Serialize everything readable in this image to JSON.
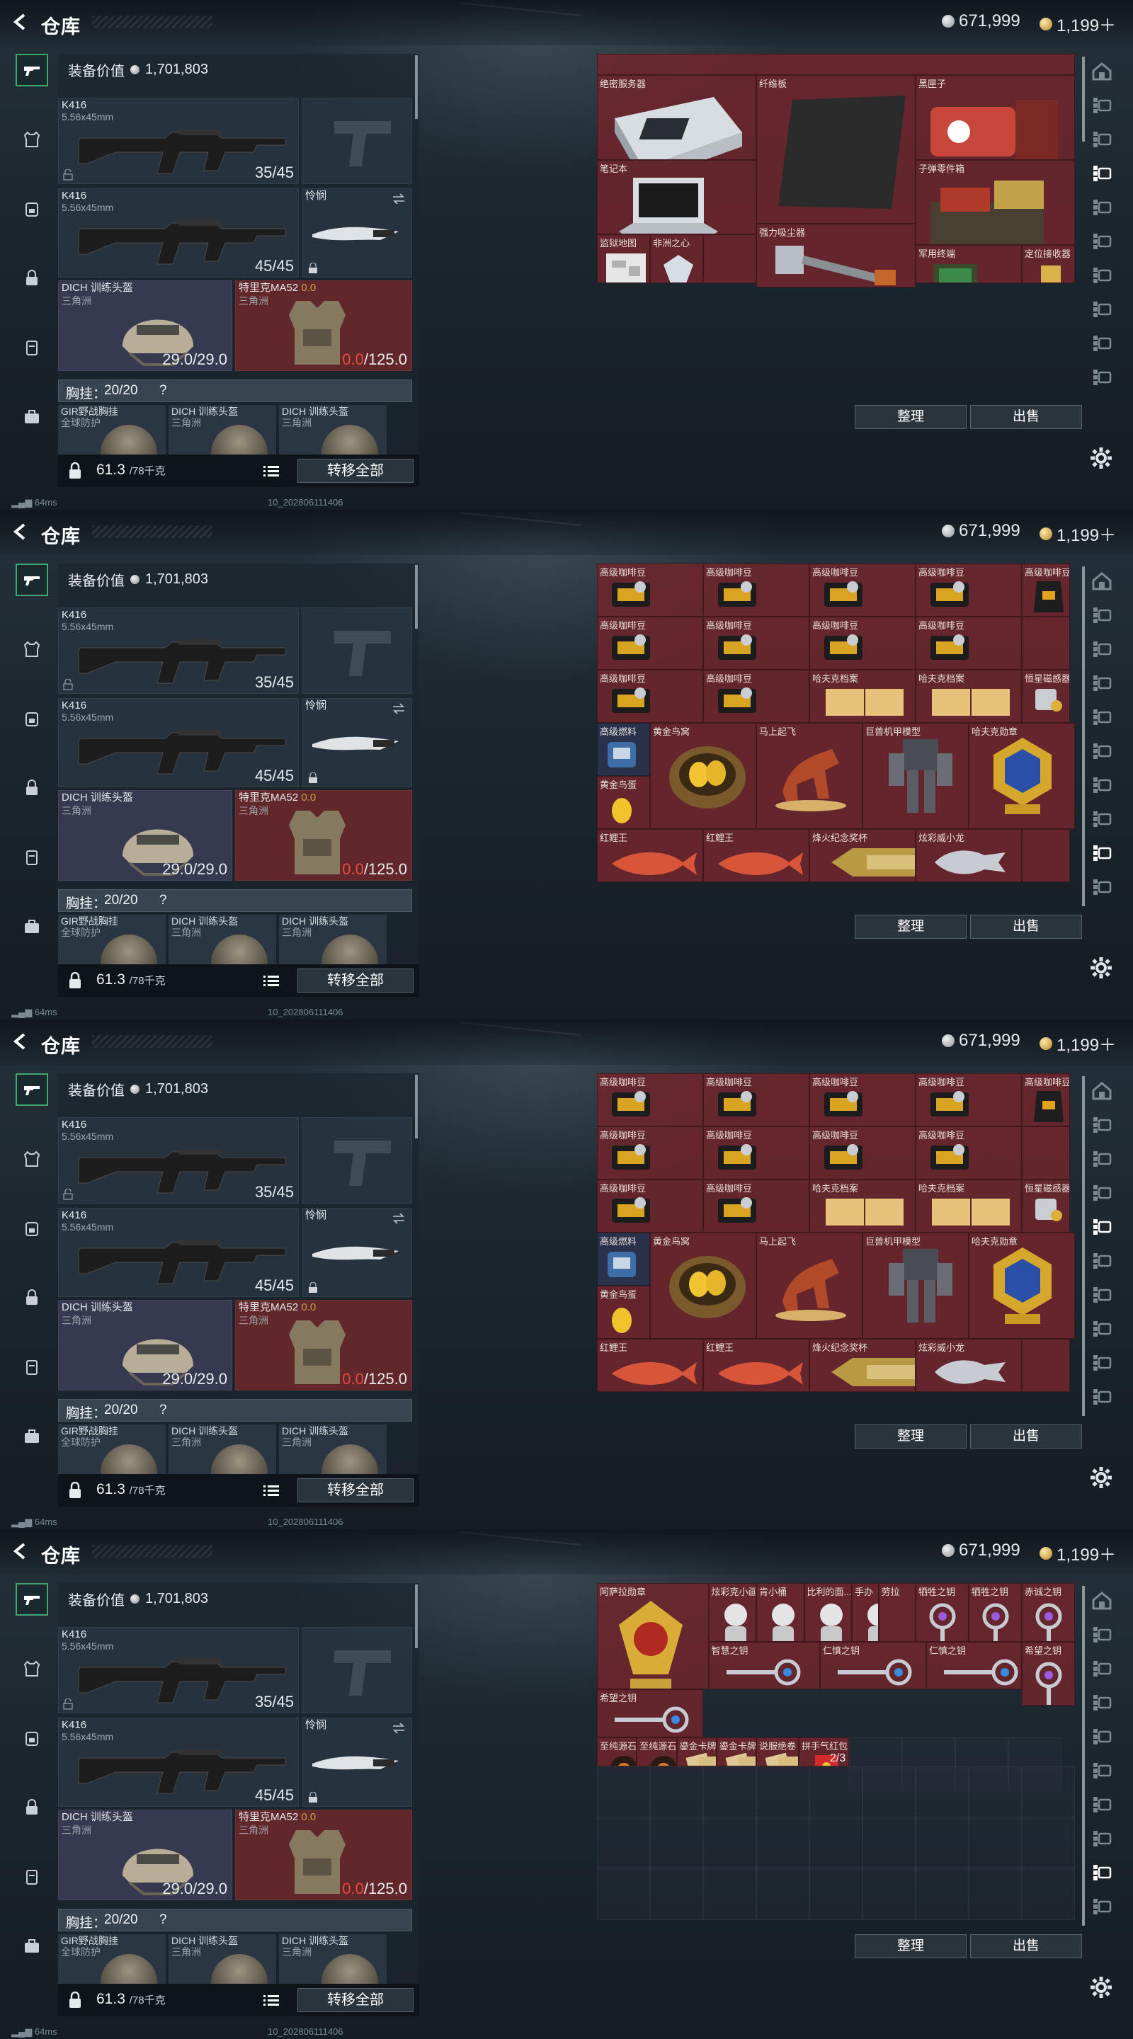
{
  "header": {
    "title": "仓库",
    "silver": "671,999",
    "gold": "1,199＋"
  },
  "equipment": {
    "value_label": "装备价值",
    "value": "1,701,803",
    "primary1": {
      "name": "K416",
      "ammo": "5.56x45mm",
      "count": "35/45"
    },
    "primary2": {
      "name": "K416",
      "ammo": "5.56x45mm",
      "count": "45/45"
    },
    "melee": {
      "name": "怜悯"
    },
    "helmet": {
      "name": "DICH 训练头盔",
      "sub": "三角洲",
      "durability": "29.0/29.0"
    },
    "armor": {
      "name": "特里克MA52 ",
      "name2": "0.0",
      "sub": "三角洲",
      "current": "0.0",
      "max": "/125.0"
    },
    "chest": {
      "label": "胸挂：",
      "count": "20/20",
      "help": "?"
    },
    "minis": [
      {
        "name": "GIR野战胸挂",
        "sub": "全球防护"
      },
      {
        "name": "DICH 训练头盔",
        "sub": "三角洲"
      },
      {
        "name": "DICH 训练头盔",
        "sub": "三角洲"
      }
    ],
    "weight": "61.3",
    "weight_max": "/78千克",
    "move_all": "转移全部"
  },
  "footer": {
    "ping": "64ms",
    "version": "10_202806111406"
  },
  "storage": {
    "sort": "整理",
    "sell": "出售"
  },
  "screen1": {
    "items": [
      {
        "name": "绝密服务器"
      },
      {
        "name": "纤维板"
      },
      {
        "name": "黑匣子"
      },
      {
        "name": "笔记本"
      },
      {
        "name": "子弹零件箱"
      },
      {
        "name": "强力吸尘器"
      },
      {
        "name": "监狱地图"
      },
      {
        "name": "非洲之心"
      },
      {
        "name": "军用终端"
      },
      {
        "name": "定位接收器"
      }
    ]
  },
  "screen2": {
    "items": [
      {
        "name": "高级咖啡豆"
      },
      {
        "name": "高级咖啡豆"
      },
      {
        "name": "高级咖啡豆"
      },
      {
        "name": "高级咖啡豆"
      },
      {
        "name": "高级咖啡豆"
      },
      {
        "name": "高级咖啡豆"
      },
      {
        "name": "高级咖啡豆"
      },
      {
        "name": "高级咖啡豆"
      },
      {
        "name": "高级咖啡豆"
      },
      {
        "name": "高级咖啡豆"
      },
      {
        "name": "高级咖啡豆"
      },
      {
        "name": "哈夫克档案"
      },
      {
        "name": "哈夫克档案"
      },
      {
        "name": "恒星磁感器"
      },
      {
        "name": "高级燃料"
      },
      {
        "name": "黄金鸟窝"
      },
      {
        "name": "马上起飞"
      },
      {
        "name": "巨兽机甲模型"
      },
      {
        "name": "哈夫克勋章"
      },
      {
        "name": "黄金鸟蛋"
      },
      {
        "name": "红鲤王"
      },
      {
        "name": "红鲤王"
      },
      {
        "name": "烽火纪念奖杯"
      },
      {
        "name": "炫彩威小龙"
      }
    ]
  },
  "screen4": {
    "items": [
      {
        "name": "阿萨拉勋章"
      },
      {
        "name": "炫彩克小画"
      },
      {
        "name": "肯小桶"
      },
      {
        "name": "比利的面..."
      },
      {
        "name": "手办"
      },
      {
        "name": "劳拉"
      },
      {
        "name": "牺牲之钥"
      },
      {
        "name": "牺牲之钥"
      },
      {
        "name": "赤诚之钥"
      },
      {
        "name": "智慧之钥"
      },
      {
        "name": "仁慎之钥"
      },
      {
        "name": "仁慎之钥"
      },
      {
        "name": "希望之钥"
      },
      {
        "name": "希望之钥"
      },
      {
        "name": "至纯源石"
      },
      {
        "name": "至纯源石"
      },
      {
        "name": "鎏金卡牌"
      },
      {
        "name": "鎏金卡牌"
      },
      {
        "name": "说服绝卷"
      },
      {
        "name": "拼手气红包",
        "count": "2/3"
      }
    ]
  }
}
